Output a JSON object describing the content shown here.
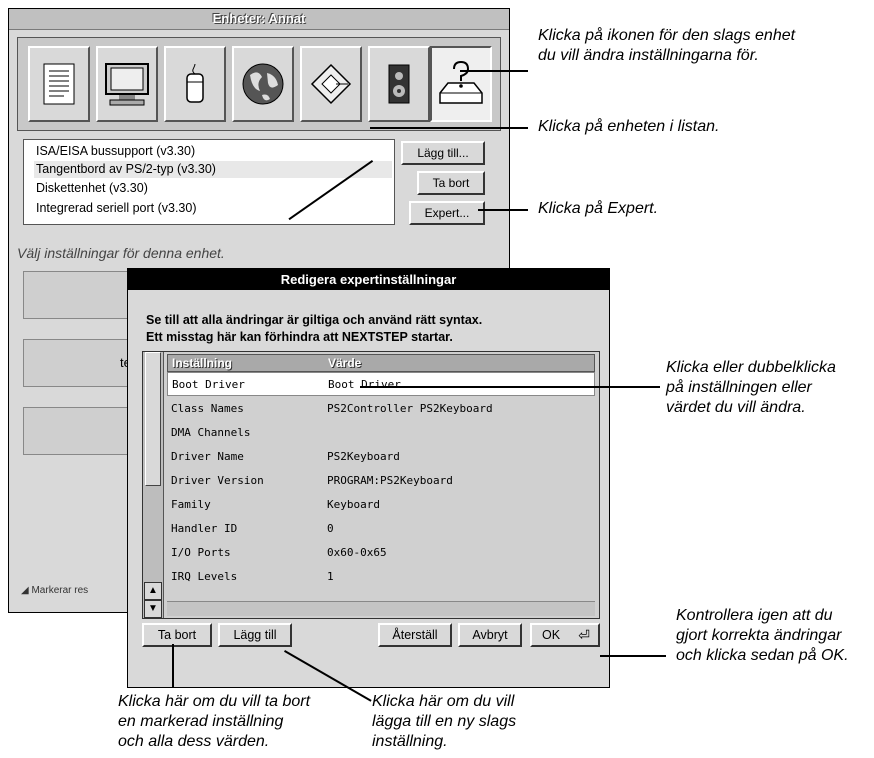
{
  "window": {
    "title": "Enheter: Annat",
    "icons": [
      "document-icon",
      "monitor-icon",
      "mouse-icon",
      "globe-icon",
      "disk-icon",
      "speaker-icon",
      "other-device-icon"
    ],
    "device_list": [
      "ISA/EISA bussupport (v3.30)",
      "Tangentbord av PS/2-typ (v3.30)",
      "Diskettenhet (v3.30)",
      "Integrerad seriell port (v3.30)"
    ],
    "buttons": {
      "add": "Lägg till...",
      "remove": "Ta bort",
      "expert": "Expert..."
    },
    "select_label": "Välj inställningar för denna enhet.",
    "partial_text": "te",
    "status_text": "◢ Markerar res"
  },
  "dialog": {
    "title": "Redigera expertinställningar",
    "warning_line1": "Se till att alla ändringar är giltiga och använd rätt syntax.",
    "warning_line2": "Ett misstag här kan förhindra att NEXTSTEP startar.",
    "columns": [
      "Inställning",
      "Värde"
    ],
    "rows": [
      {
        "setting": "Boot Driver",
        "value": "Boot Driver"
      },
      {
        "setting": "Class Names",
        "value": "PS2Controller PS2Keyboard"
      },
      {
        "setting": "DMA Channels",
        "value": ""
      },
      {
        "setting": "Driver Name",
        "value": "PS2Keyboard"
      },
      {
        "setting": "Driver Version",
        "value": "PROGRAM:PS2Keyboard"
      },
      {
        "setting": "Family",
        "value": "Keyboard"
      },
      {
        "setting": "Handler ID",
        "value": "0"
      },
      {
        "setting": "I/O Ports",
        "value": "0x60-0x65"
      },
      {
        "setting": "IRQ Levels",
        "value": "1"
      }
    ],
    "buttons": {
      "remove": "Ta bort",
      "add": "Lägg till",
      "reset": "Återställ",
      "cancel": "Avbryt",
      "ok": "OK"
    }
  },
  "callouts": {
    "icon": [
      "Klicka på ikonen för den slags enhet",
      "du vill ändra inställningarna för."
    ],
    "list": [
      "Klicka på enheten i listan."
    ],
    "expert": [
      "Klicka på Expert."
    ],
    "edit": [
      "Klicka eller dubbelklicka",
      "på inställningen eller",
      "värdet du vill ändra."
    ],
    "ok": [
      "Kontrollera igen att du",
      "gjort korrekta ändringar",
      "och klicka sedan på OK."
    ],
    "remove": [
      "Klicka här om du vill ta bort",
      "en markerad inställning",
      "och alla dess värden."
    ],
    "add": [
      "Klicka här om du vill",
      "lägga till en ny slags",
      "inställning."
    ]
  }
}
